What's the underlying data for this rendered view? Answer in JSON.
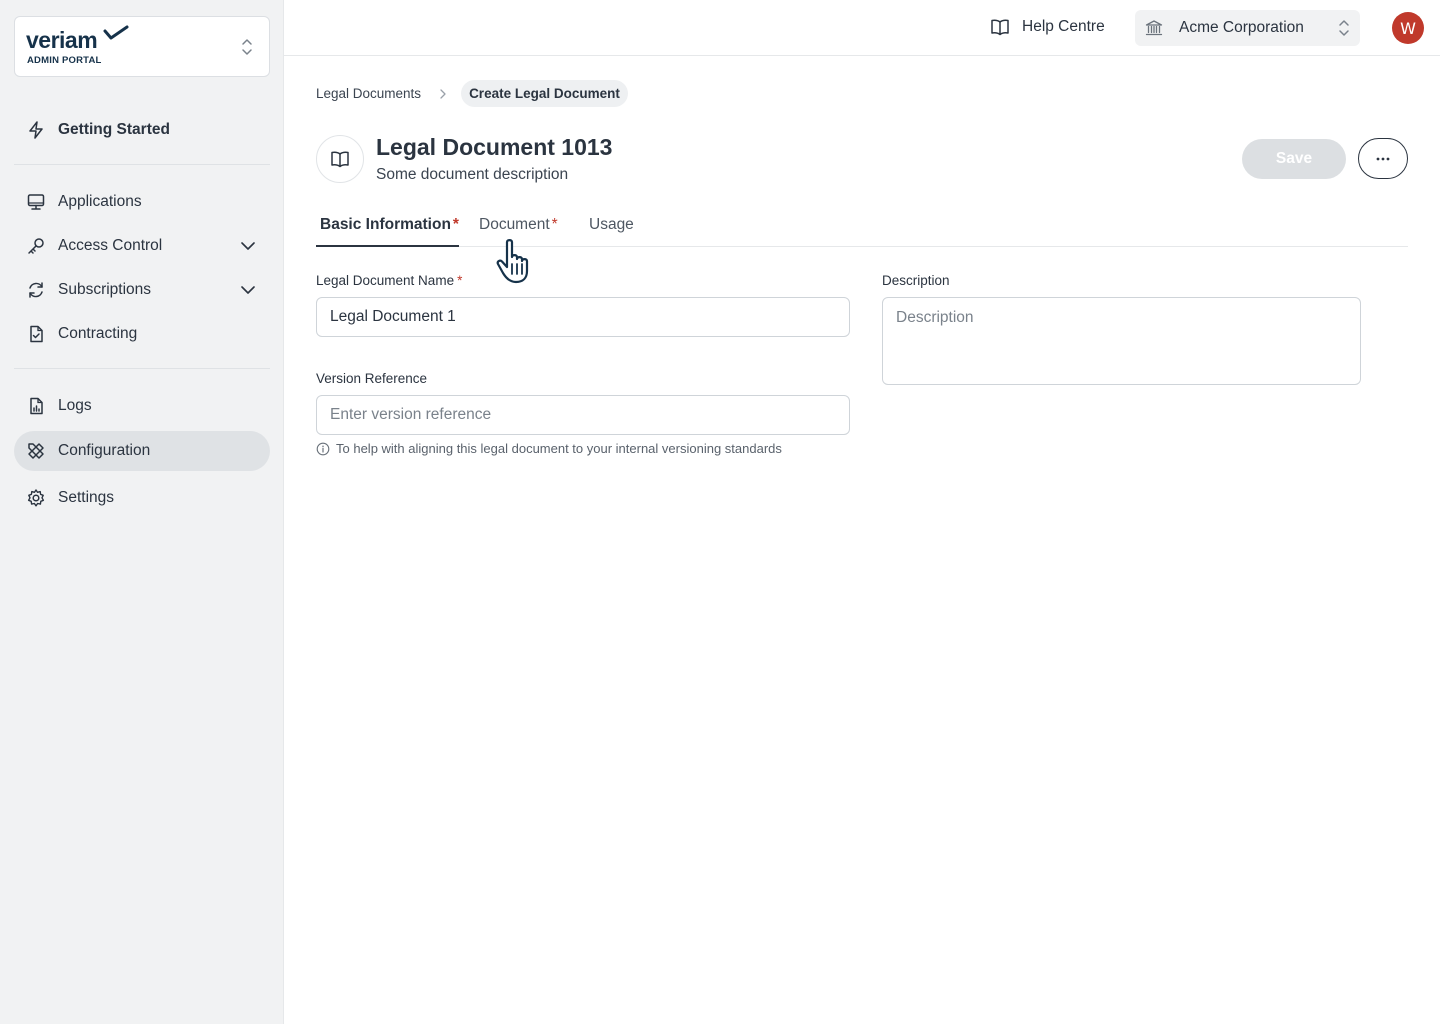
{
  "brand": {
    "name": "veriam",
    "subtitle": "ADMIN PORTAL"
  },
  "sidebar": {
    "items": [
      {
        "label": "Getting Started",
        "icon": "lightning-icon"
      },
      {
        "label": "Applications",
        "icon": "monitor-icon"
      },
      {
        "label": "Access Control",
        "icon": "key-icon",
        "expandable": true
      },
      {
        "label": "Subscriptions",
        "icon": "refresh-icon",
        "expandable": true
      },
      {
        "label": "Contracting",
        "icon": "file-check-icon"
      },
      {
        "label": "Logs",
        "icon": "file-chart-icon"
      },
      {
        "label": "Configuration",
        "icon": "tools-icon",
        "active": true
      },
      {
        "label": "Settings",
        "icon": "gear-icon"
      }
    ]
  },
  "topbar": {
    "help_label": "Help Centre",
    "tenant_name": "Acme Corporation",
    "avatar_initial": "W"
  },
  "breadcrumb": {
    "parent": "Legal Documents",
    "current": "Create Legal Document"
  },
  "header": {
    "title": "Legal Document 1013",
    "description": "Some document description",
    "save_label": "Save",
    "more_label": "···"
  },
  "tabs": [
    {
      "label": "Basic Information",
      "required": "*",
      "active": true
    },
    {
      "label": "Document",
      "required": "*",
      "active": false
    },
    {
      "label": "Usage",
      "required": "",
      "active": false
    }
  ],
  "form": {
    "name_label": "Legal Document Name",
    "name_required": "*",
    "name_value": "Legal Document 1",
    "version_label": "Version Reference",
    "version_placeholder": "Enter version reference",
    "version_hint": "To help with aligning this legal document to your internal versioning standards",
    "description_label": "Description",
    "description_placeholder": "Description"
  },
  "colors": {
    "accent_dark": "#2b3440",
    "brand_navy": "#16324a",
    "required_red": "#c0392b",
    "avatar_bg": "#c0392b",
    "sidebar_bg": "#f1f2f3"
  }
}
